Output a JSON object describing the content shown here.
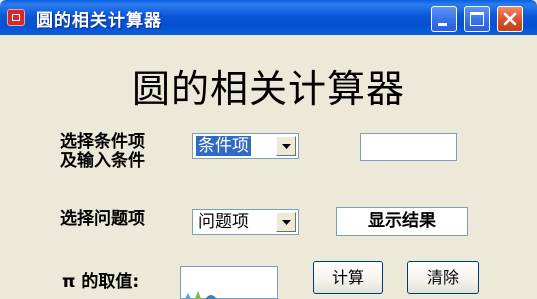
{
  "window": {
    "title": "圆的相关计算器",
    "controls": {
      "minimize": "minimize",
      "maximize": "maximize",
      "close": "close"
    }
  },
  "main": {
    "heading": "圆的相关计算器",
    "condition": {
      "label_line1": "选择条件项",
      "label_line2": "及输入条件",
      "selected": "条件项",
      "input_value": ""
    },
    "question": {
      "label": "选择问题项",
      "selected": "问题项",
      "result_text": "显示结果"
    },
    "pi": {
      "label": "π 的取值:",
      "input_value": ""
    },
    "buttons": {
      "calculate": "计算",
      "clear": "清除"
    }
  },
  "colors": {
    "titlebar": "#0a58d8",
    "window_bg": "#ece9d8",
    "selection": "#316ac5",
    "close_button": "#d9532d"
  }
}
